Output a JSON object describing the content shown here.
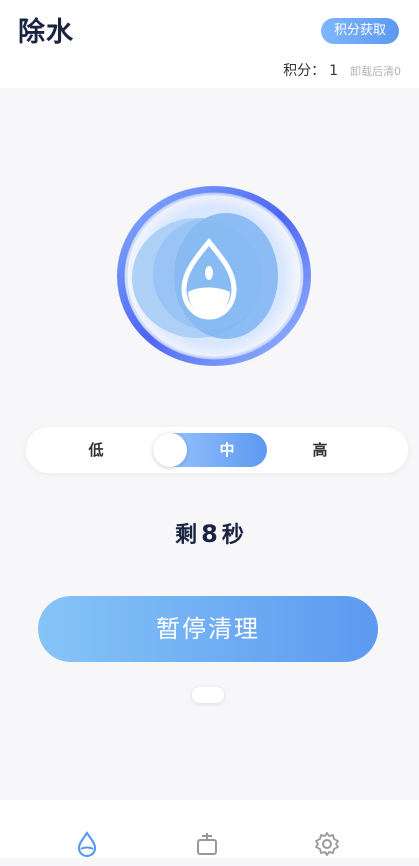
{
  "header": {
    "title": "除水",
    "points_button": "积分获取",
    "points_label": "积分：",
    "points_value": "1",
    "points_note": "卸载后清0"
  },
  "level": {
    "options": [
      "低",
      "中",
      "高"
    ],
    "selected": "中"
  },
  "status": {
    "prefix": "剩",
    "seconds": "8",
    "suffix": "秒"
  },
  "action": {
    "pause_label": "暂停清理"
  },
  "tabs": {
    "items": [
      "water-drop-icon",
      "cleaner-icon",
      "gear-icon"
    ],
    "active": "water-drop-icon"
  },
  "colors": {
    "accent": "#5d99f0",
    "accent_light": "#86c4f7",
    "title": "#1a2340"
  }
}
